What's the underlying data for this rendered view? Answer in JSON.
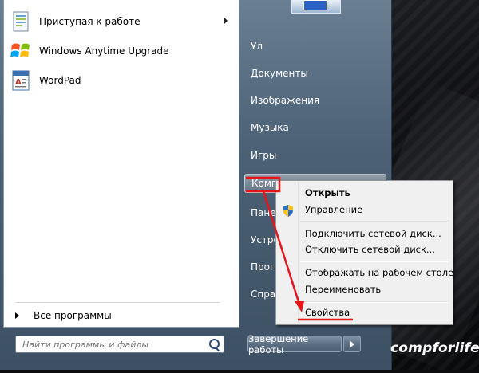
{
  "start_menu": {
    "pinned": [
      {
        "label": "Приступая к работе",
        "icon": "getting-started-icon",
        "has_submenu": true
      },
      {
        "label": "Windows Anytime Upgrade",
        "icon": "windows-flag-icon",
        "has_submenu": false
      },
      {
        "label": "WordPad",
        "icon": "wordpad-icon",
        "has_submenu": false
      }
    ],
    "all_programs_label": "Все программы",
    "search": {
      "placeholder": "Найти программы и файлы"
    },
    "right_items": [
      {
        "label": "Ул"
      },
      {
        "label": "Документы"
      },
      {
        "label": "Изображения"
      },
      {
        "label": "Музыка"
      },
      {
        "label": "Игры"
      },
      {
        "label": "Компь"
      },
      {
        "label": "Панел"
      },
      {
        "label": "Устро"
      },
      {
        "label": "Прогр"
      },
      {
        "label": "Справ"
      }
    ],
    "shutdown_label": "Завершение работы"
  },
  "context_menu": {
    "items": [
      {
        "label": "Открыть",
        "bold": true
      },
      {
        "label": "Управление",
        "icon": "uac-shield-icon"
      },
      {
        "label": "Подключить сетевой диск..."
      },
      {
        "label": "Отключить сетевой диск..."
      },
      {
        "label": "Отображать на рабочем столе"
      },
      {
        "label": "Переименовать"
      },
      {
        "label": "Свойства"
      }
    ]
  },
  "watermark": "compforlife.ru",
  "colors": {
    "annotation": "#e8141b",
    "start_menu": "#4c6175",
    "highlight": "#ffffff"
  }
}
